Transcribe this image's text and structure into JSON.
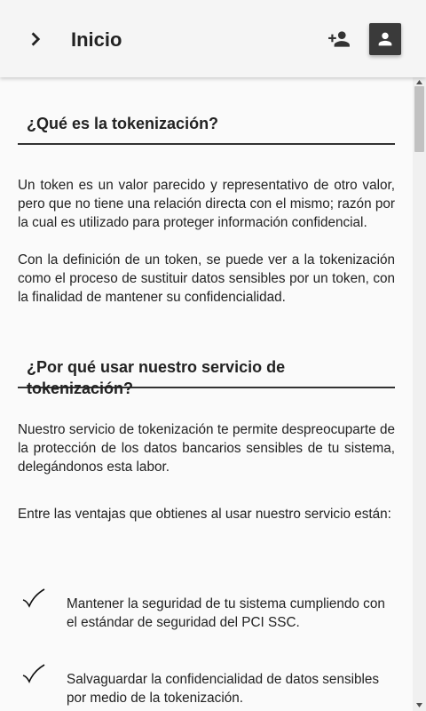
{
  "appbar": {
    "title": "Inicio",
    "back_icon": "chevron-right-icon",
    "add_user_icon": "person-add-icon",
    "profile_icon": "person-icon",
    "profile_bg": "#3a3a3a"
  },
  "sections": [
    {
      "heading": "¿Qué es la tokenización?",
      "paragraphs": [
        "Un token es un valor parecido y representativo de otro valor, pero que no tiene una relación directa con el mismo; razón por la cual es utilizado para proteger información confidencial.",
        "Con la definición de un token, se puede ver a la tokenización como el proceso de sustituir datos sensibles por un token, con la finalidad de mantener su confidencialidad."
      ]
    },
    {
      "heading": "¿Por qué usar nuestro servicio de tokenización?",
      "paragraphs": [
        "Nuestro servicio de tokenización te permite despreocuparte de la protección de los datos bancarios sensibles de tu sistema, delegándonos esta labor.",
        "Entre las ventajas que obtienes al usar nuestro servicio están:"
      ],
      "benefits": [
        "Mantener la seguridad de tu sistema cumpliendo con el estándar de seguridad del PCI SSC.",
        "Salvaguardar la confidencialidad de datos sensibles por medio de la tokenización."
      ]
    }
  ]
}
